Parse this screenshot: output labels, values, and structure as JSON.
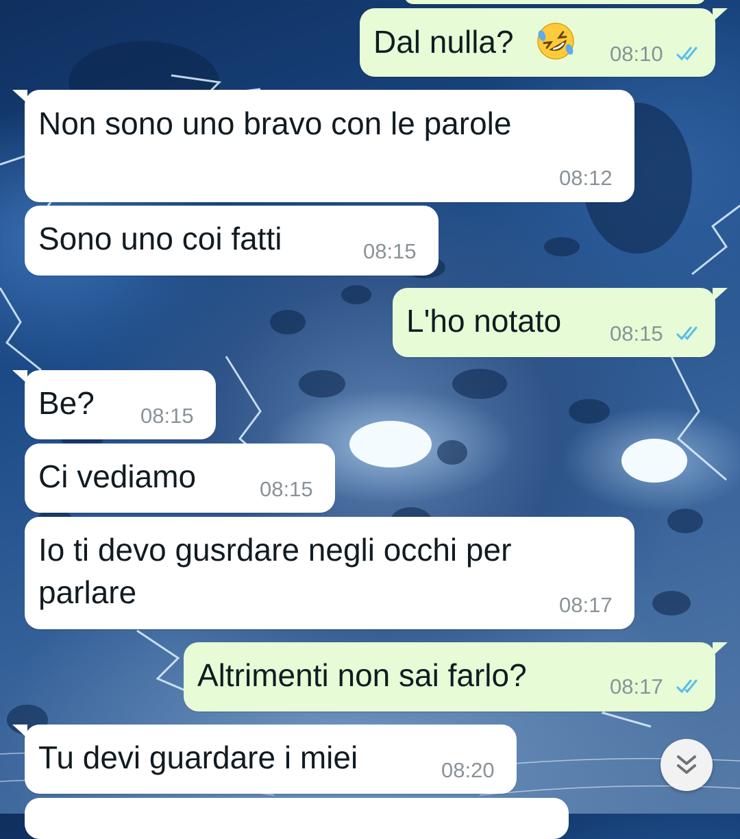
{
  "chat": {
    "messages": [
      {
        "direction": "outgoing",
        "text": "Dal nulla?",
        "emoji": "rolling-on-the-floor-laughing",
        "time": "08:10",
        "status": "read"
      },
      {
        "direction": "incoming",
        "text": "Non sono uno bravo con le parole",
        "time": "08:12"
      },
      {
        "direction": "incoming",
        "text": "Sono uno coi fatti",
        "time": "08:15"
      },
      {
        "direction": "outgoing",
        "text": "L'ho notato",
        "time": "08:15",
        "status": "read"
      },
      {
        "direction": "incoming",
        "text": "Be?",
        "time": "08:15"
      },
      {
        "direction": "incoming",
        "text": "Ci vediamo",
        "time": "08:15"
      },
      {
        "direction": "incoming",
        "text": "Io ti devo gusrdare negli occhi per\nparlare",
        "time": "08:17"
      },
      {
        "direction": "outgoing",
        "text": "Altrimenti non sai farlo?",
        "time": "08:17",
        "status": "read"
      },
      {
        "direction": "incoming",
        "text": "Tu devi guardare i miei",
        "time": "08:20"
      }
    ],
    "scroll_down_icon": "double-chevron-down-icon"
  },
  "colors": {
    "incoming_bubble": "#ffffff",
    "outgoing_bubble": "#e7fcd6",
    "read_ticks": "#53bdeb",
    "timestamp": "#8a9297"
  }
}
